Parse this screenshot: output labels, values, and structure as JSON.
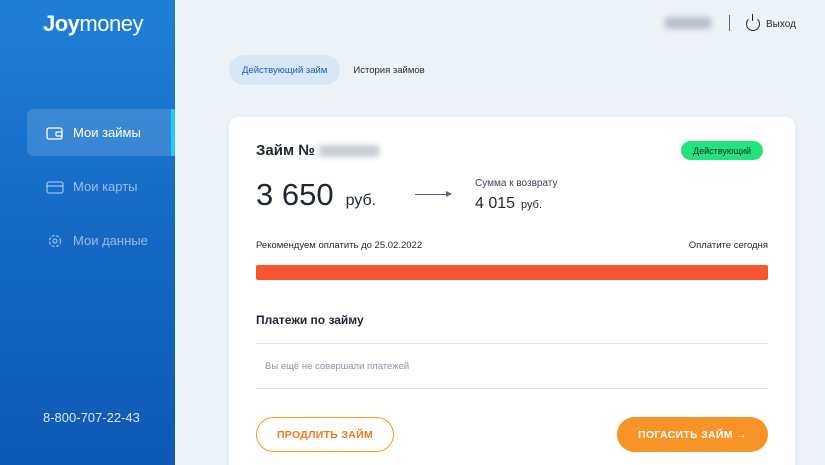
{
  "sidebar": {
    "logo": {
      "bold": "Joy",
      "light": "money"
    },
    "items": [
      {
        "label": "Мои займы",
        "icon": "wallet-icon",
        "active": true
      },
      {
        "label": "Мои карты",
        "icon": "card-icon",
        "active": false
      },
      {
        "label": "Мои данные",
        "icon": "gear-icon",
        "active": false
      }
    ],
    "phone": "8-800-707-22-43"
  },
  "header": {
    "logout_label": "Выход"
  },
  "tabs": [
    {
      "label": "Действующий займ",
      "active": true
    },
    {
      "label": "История займов",
      "active": false
    }
  ],
  "loan": {
    "title": "Займ №",
    "status": "Действующий",
    "amount": "3 650",
    "amount_unit": "руб.",
    "return_label": "Сумма к возврату",
    "return_amount": "4 015",
    "return_unit": "руб.",
    "recommendation": "Рекомендуем оплатить до 25.02.2022",
    "due_note": "Оплатите сегодня",
    "progress": 1.0,
    "payments_title": "Платежи по займу",
    "payments_empty": "Вы ещё не совершали платежей",
    "extend_button": "ПРОДЛИТЬ ЗАЙМ",
    "pay_button": "ПОГАСИТЬ ЗАЙМ →"
  },
  "colors": {
    "accent_orange": "#f89327",
    "status_green": "#21e47a",
    "progress_red": "#f65531",
    "sidebar_blue": "#1469c4"
  }
}
